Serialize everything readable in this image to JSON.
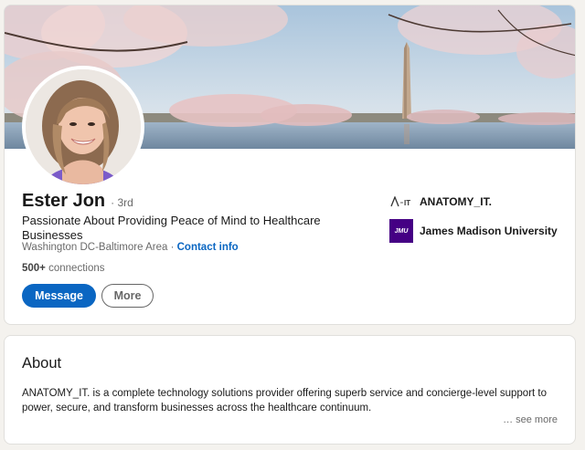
{
  "profile": {
    "name": "Ester Jon",
    "degree": "· 3rd",
    "headline": "Passionate About Providing Peace of Mind to Healthcare Businesses",
    "location": "Washington DC-Baltimore Area",
    "location_separator": "·",
    "contact_info_label": "Contact info",
    "connections_count": "500+",
    "connections_label": "connections",
    "message_button_label": "Message",
    "more_button_label": "More"
  },
  "organizations": [
    {
      "name": "ANATOMY_IT.",
      "logo_text": "A IT",
      "logo_icon": "anatomy-it-logo"
    },
    {
      "name": "James Madison University",
      "logo_text": "JMU",
      "logo_icon": "jmu-logo"
    }
  ],
  "about": {
    "title": "About",
    "text": "ANATOMY_IT. is a complete technology solutions provider offering superb service and concierge-level support to power, secure, and transform businesses across the healthcare continuum.",
    "see_more_label": "… see more"
  },
  "colors": {
    "brand_blue": "#0a66c2",
    "page_background": "#f4f2ee",
    "jmu_purple": "#450084"
  }
}
